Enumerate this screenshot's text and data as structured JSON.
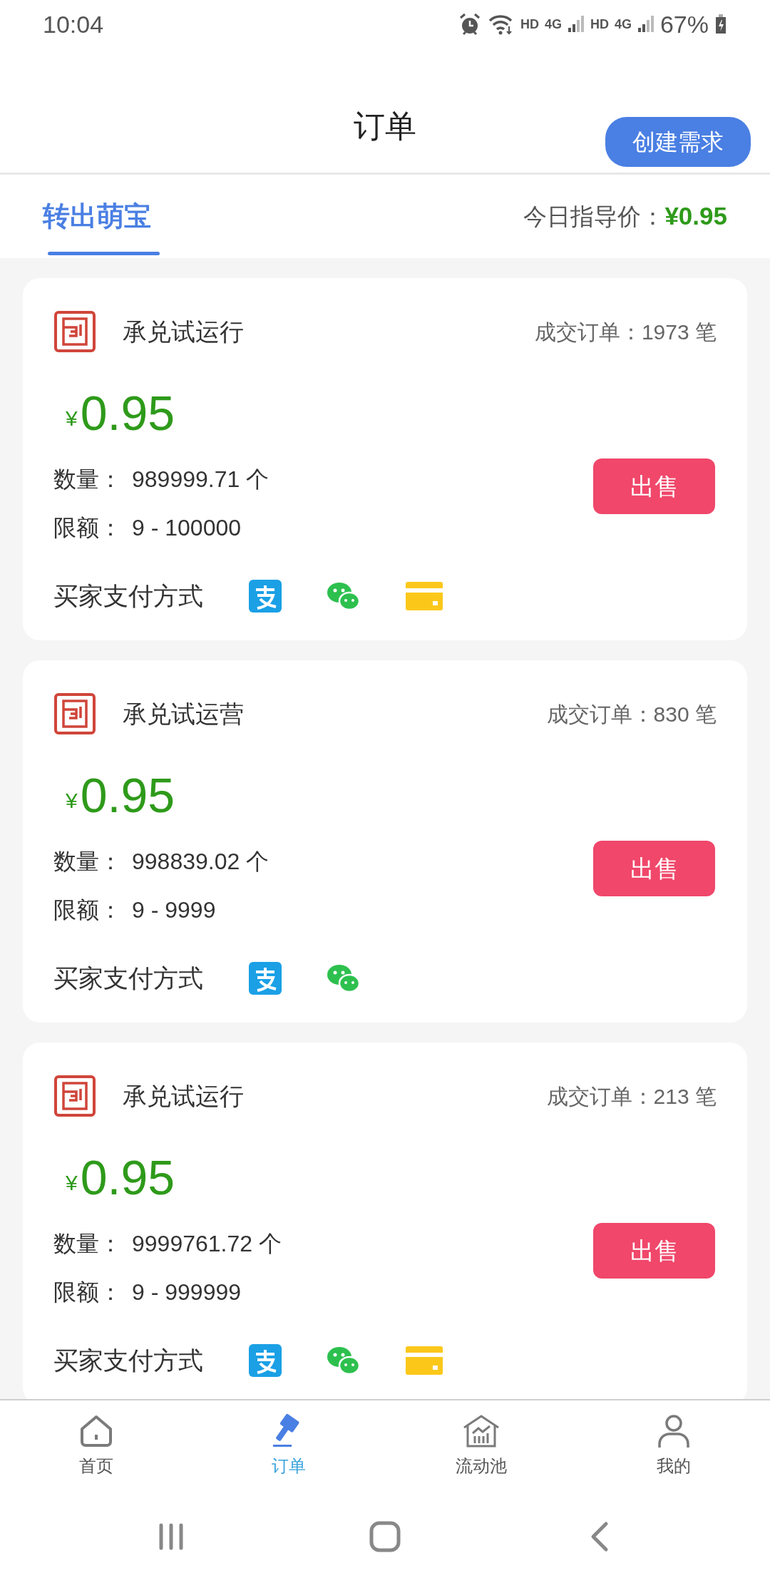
{
  "status_bar": {
    "time": "10:04",
    "labels": [
      "HD",
      "4G",
      "HD",
      "4G"
    ],
    "battery": "67%"
  },
  "header": {
    "title": "订单",
    "action": "创建需求"
  },
  "tabs": [
    {
      "label": "转出萌宝",
      "selected": true
    }
  ],
  "guide_price": {
    "label": "今日指导价：",
    "value": "¥0.95"
  },
  "listings": [
    {
      "name": "承兑试运行",
      "orders": "成交订单：1973 笔",
      "currency": "¥",
      "price": "0.95",
      "quantity_label": "数量：",
      "quantity": "989999.71 个",
      "limit_label": "限额：",
      "limit": "9 - 100000",
      "action": "出售",
      "payment_label": "买家支付方式",
      "payments": [
        {
          "kind": "alipay"
        },
        {
          "kind": "wechat"
        },
        {
          "kind": "card"
        }
      ]
    },
    {
      "name": "承兑试运营",
      "orders": "成交订单：830 笔",
      "currency": "¥",
      "price": "0.95",
      "quantity_label": "数量：",
      "quantity": "998839.02 个",
      "limit_label": "限额：",
      "limit": "9 - 9999",
      "action": "出售",
      "payment_label": "买家支付方式",
      "payments": [
        {
          "kind": "alipay"
        },
        {
          "kind": "wechat"
        }
      ]
    },
    {
      "name": "承兑试运行",
      "orders": "成交订单：213 笔",
      "currency": "¥",
      "price": "0.95",
      "quantity_label": "数量：",
      "quantity": "9999761.72 个",
      "limit_label": "限额：",
      "limit": "9 - 999999",
      "action": "出售",
      "payment_label": "买家支付方式",
      "payments": [
        {
          "kind": "alipay"
        },
        {
          "kind": "wechat"
        },
        {
          "kind": "card"
        }
      ]
    }
  ],
  "bottom_nav": [
    {
      "kind": "home",
      "label": "首页",
      "selected": false
    },
    {
      "kind": "gavel",
      "label": "订单",
      "selected": true
    },
    {
      "kind": "pool",
      "label": "流动池",
      "selected": false
    },
    {
      "kind": "user",
      "label": "我的",
      "selected": false
    }
  ]
}
